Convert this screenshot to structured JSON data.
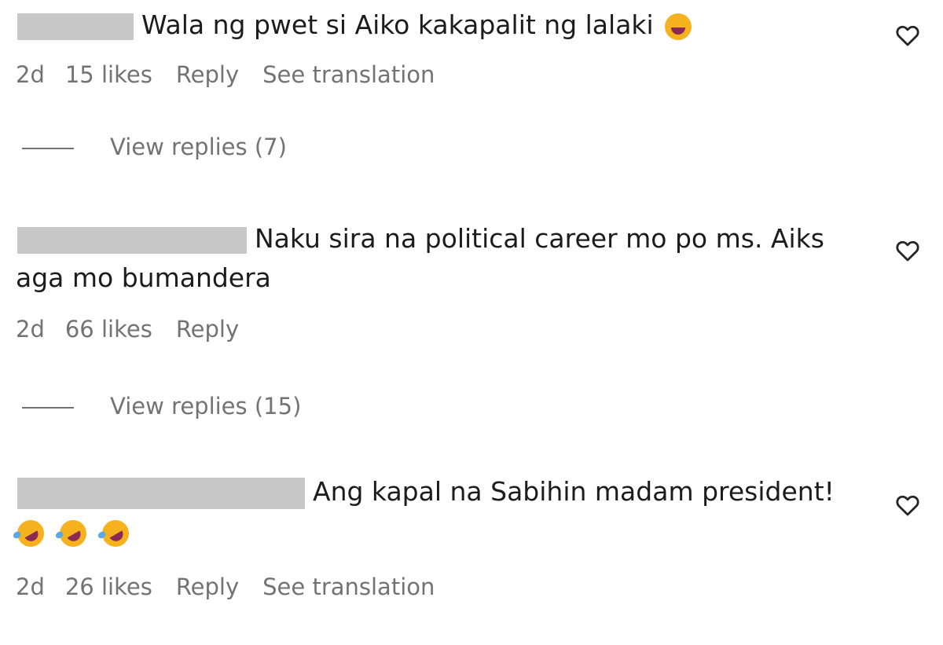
{
  "comments": [
    {
      "text": "Wala ng pwet si Aiko kakapalit ng lalaki",
      "emoji": "laughing-emoji",
      "time": "2d",
      "likes": "15 likes",
      "reply": "Reply",
      "translation": "See translation",
      "view_replies": "View replies (7)"
    },
    {
      "text_line1": "Naku sira na political career mo po ms. Aiks",
      "text_line2": "aga mo bumandera",
      "time": "2d",
      "likes": "66 likes",
      "reply": "Reply",
      "view_replies": "View replies (15)"
    },
    {
      "text": "Ang kapal na Sabihin madam president!",
      "emojis": [
        "rofl-emoji",
        "rofl-emoji",
        "rofl-emoji"
      ],
      "time": "2d",
      "likes": "26 likes",
      "reply": "Reply",
      "translation": "See translation"
    }
  ],
  "colors": {
    "text": "#1c1c1c",
    "meta": "#737373",
    "redaction": "#c8c8c8"
  }
}
